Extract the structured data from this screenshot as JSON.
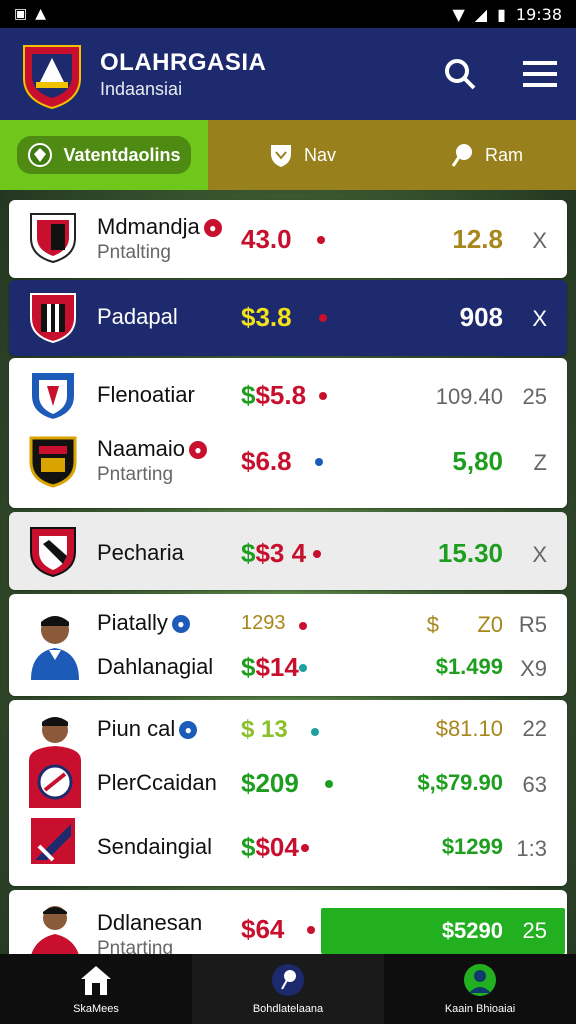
{
  "status_bar": {
    "time": "19:38"
  },
  "header": {
    "title": "OLAHRGASIA",
    "subtitle": "Indaansiai"
  },
  "tabs": [
    {
      "label": "Vatentdaolins"
    },
    {
      "label": "Nav"
    },
    {
      "label": "Ram"
    }
  ],
  "rows": [
    {
      "name": "Mdmandja",
      "sub": "Pntalting",
      "price": "43.0",
      "value": "12.8",
      "end": "X"
    },
    {
      "name": "Padapal",
      "price": "$3.8",
      "value": "908",
      "end": "X"
    },
    {
      "name": "Flenoatiar",
      "price": "$5.8",
      "value": "109.40",
      "end": "25"
    },
    {
      "name": "Naamaio",
      "sub": "Pntarting",
      "price": "$6.8",
      "value": "5,80",
      "end": "Z"
    },
    {
      "name": "Pecharia",
      "price": "$3 4",
      "value": "15.30",
      "end": "X"
    },
    {
      "name": "Piatally",
      "price": "1293",
      "value1_a": "$",
      "value1_b": "Z0",
      "end": "R5"
    },
    {
      "name": "Dahlanagial",
      "price": "$14",
      "value": "$1.499",
      "end": "X9"
    },
    {
      "name": "Piun cal",
      "price": "$ 13",
      "value": "$81.10",
      "end": "22"
    },
    {
      "name": "PlerCcaidan",
      "price": "$209",
      "value": "$,$79.90",
      "end": "63"
    },
    {
      "name": "Sendaingial",
      "price": "$04",
      "value": "$1299",
      "end": "1:3"
    },
    {
      "name": "Ddlanesan",
      "sub": "Pntarting",
      "price": "$64",
      "value": "$5290",
      "end": "25"
    }
  ],
  "bottom_nav": [
    {
      "label": "SkaMees",
      "icon": "home-icon"
    },
    {
      "label": "Bohdlatelaana",
      "icon": "pin-icon"
    },
    {
      "label": "Kaain Bhioaiai",
      "icon": "profile-icon"
    }
  ],
  "colors": {
    "navy": "#1d2a6e",
    "green": "#6fc71c",
    "olive": "#98801c",
    "red": "#c8102e",
    "price_green": "#1e9e1e",
    "gold": "#a7861b"
  }
}
